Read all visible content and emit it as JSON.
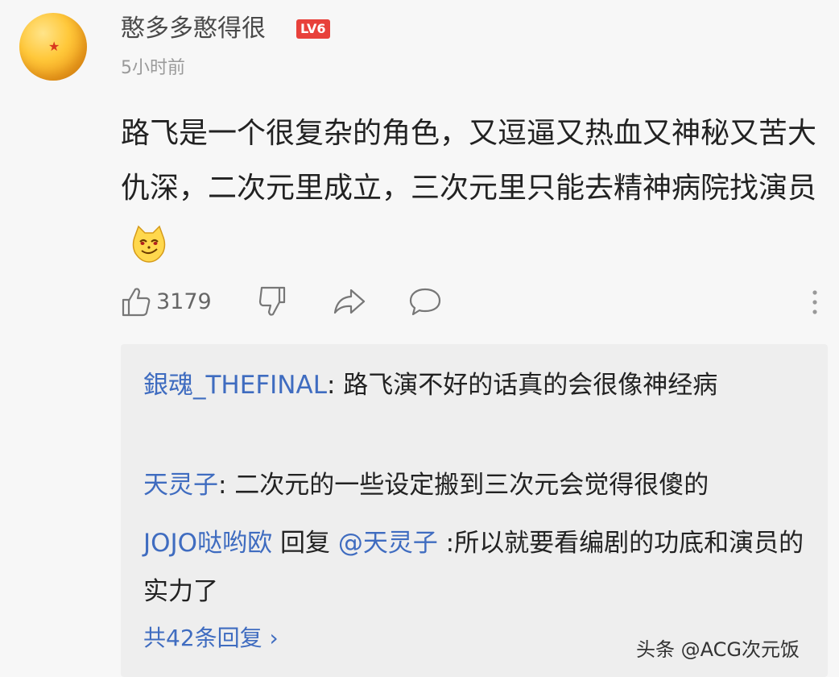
{
  "comment": {
    "author": "憨多多憨得很",
    "level": "LV6",
    "time": "5小时前",
    "text": "路飞是一个很复杂的角色，又逗逼又热血又神秘又苦大仇深，二次元里成立，三次元里只能去精神病院找演员",
    "emoji_icon": "cat-smirk-emoji",
    "likes": "3179"
  },
  "replies": [
    {
      "name": "銀魂_THEFINAL",
      "text": ": 路飞演不好的话真的会很像神经病"
    },
    {
      "name": "天灵子",
      "text": ": 二次元的一些设定搬到三次元会觉得很傻的"
    },
    {
      "name": "JOJO哒哟欧",
      "middle": " 回复 ",
      "mention": "@天灵子",
      "text": " :所以就要看编剧的功底和演员的实力了"
    }
  ],
  "more_replies": "共42条回复 ›",
  "watermark": "头条 @ACG次元饭",
  "colors": {
    "link": "#3f6cc0",
    "badge": "#e8413b",
    "reply_bg": "#eeeeee",
    "page_bg": "#f7f7f7"
  }
}
